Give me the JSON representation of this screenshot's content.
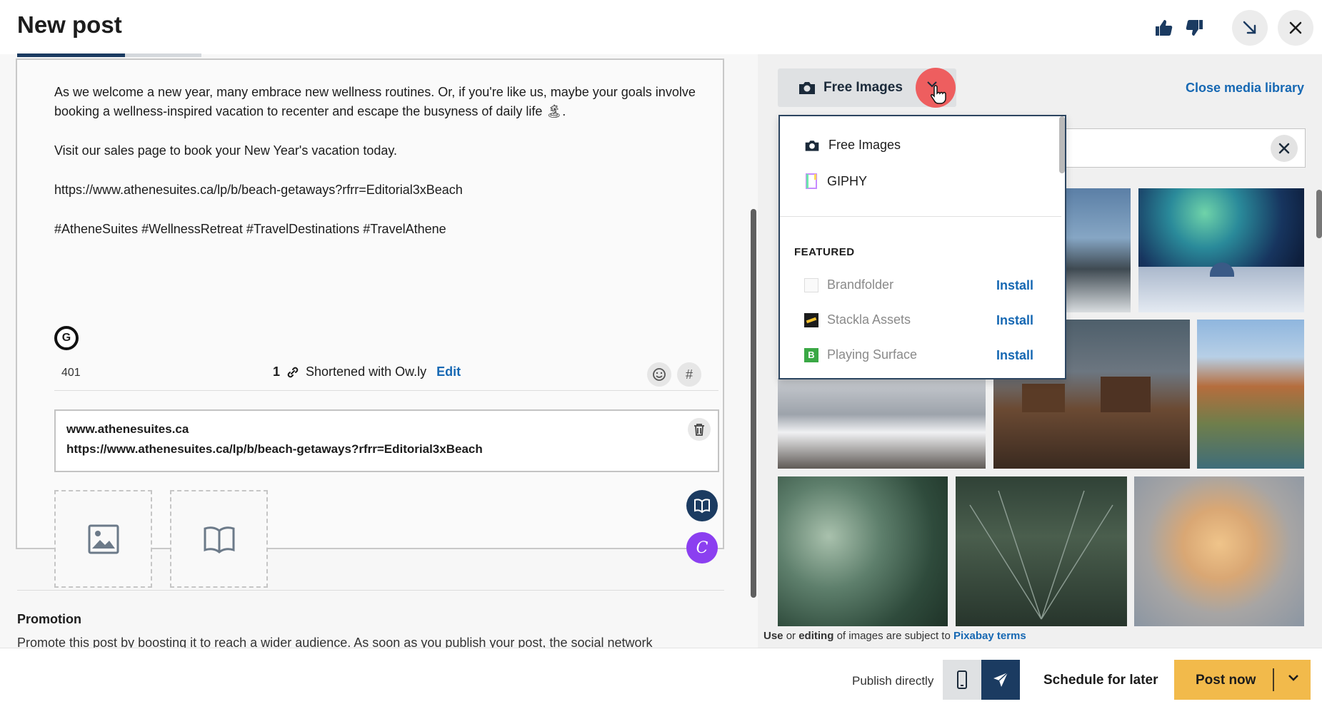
{
  "header": {
    "title": "New post"
  },
  "composer": {
    "paragraph1_line1": "As we welcome a new year, many embrace new wellness routines. Or, if you're like us, maybe your  goals involve",
    "paragraph1_line2": "booking a wellness-inspired vacation to recenter and escape the busyness of daily life 🏝.",
    "paragraph2": "Visit our sales page to book your New Year's vacation today.",
    "link_text": "https://www.athenesuites.ca/lp/b/beach-getaways?rfrr=Editorial3xBeach",
    "hashtags": "#AtheneSuites #WellnessRetreat #TravelDestinations #TravelAthene",
    "char_count": "401",
    "link_count": "1",
    "shortened_label": "Shortened with Ow.ly",
    "edit_label": "Edit",
    "link_preview": {
      "domain": "www.athenesuites.ca",
      "url": "https://www.athenesuites.ca/lp/b/beach-getaways?rfrr=Editorial3xBeach"
    }
  },
  "promotion": {
    "heading": "Promotion",
    "text": "Promote this post by boosting it to reach a wider audience. As soon as you publish your post, the social network"
  },
  "media_library": {
    "source_button_label": "Free Images",
    "close_label": "Close media library",
    "dropdown": {
      "sources": [
        "Free Images",
        "GIPHY"
      ],
      "featured_heading": "FEATURED",
      "featured_apps": [
        {
          "name": "Brandfolder",
          "action": "Install"
        },
        {
          "name": "Stackla Assets",
          "action": "Install"
        },
        {
          "name": "Playing Surface",
          "action": "Install"
        }
      ]
    },
    "terms_use": "Use",
    "terms_or": "or",
    "terms_editing": "editing",
    "terms_middle": "of images are subject to",
    "terms_link": "Pixabay terms"
  },
  "footer": {
    "publish_directly": "Publish directly",
    "schedule_label": "Schedule for later",
    "post_now_label": "Post now"
  },
  "colors": {
    "accent_navy": "#1b3b61",
    "link_blue": "#1668b3",
    "post_now_yellow": "#f2ba4b",
    "cursor_highlight": "#ef5354"
  }
}
